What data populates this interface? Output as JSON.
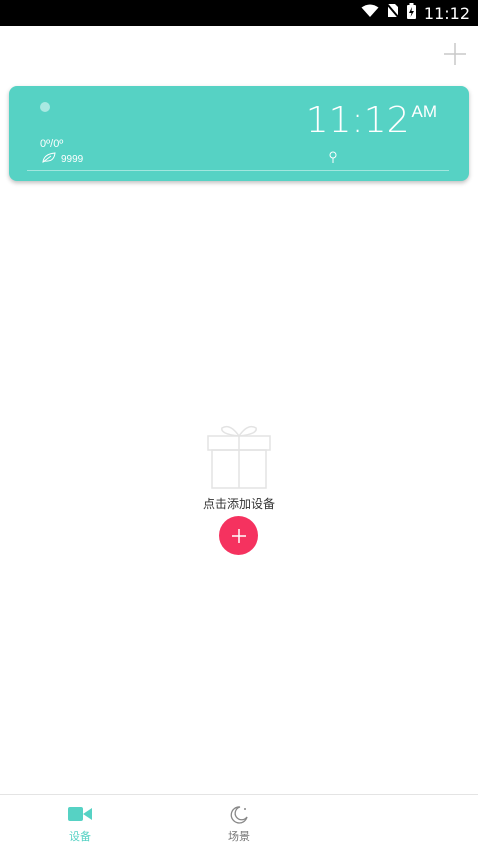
{
  "status_bar": {
    "time": "11:12"
  },
  "weather_card": {
    "temperature": "0º/0º",
    "aqi_value": "9999",
    "clock_time": "11:12",
    "clock_ampm": "AM"
  },
  "empty_state": {
    "label": "点击添加设备"
  },
  "bottom_nav": {
    "items": [
      {
        "label": "设备",
        "active": true
      },
      {
        "label": "场景",
        "active": false
      }
    ]
  },
  "colors": {
    "accent": "#56d2c4",
    "fab": "#f5325f",
    "active_tab": "#56d2c4",
    "inactive_tab": "#777777"
  }
}
